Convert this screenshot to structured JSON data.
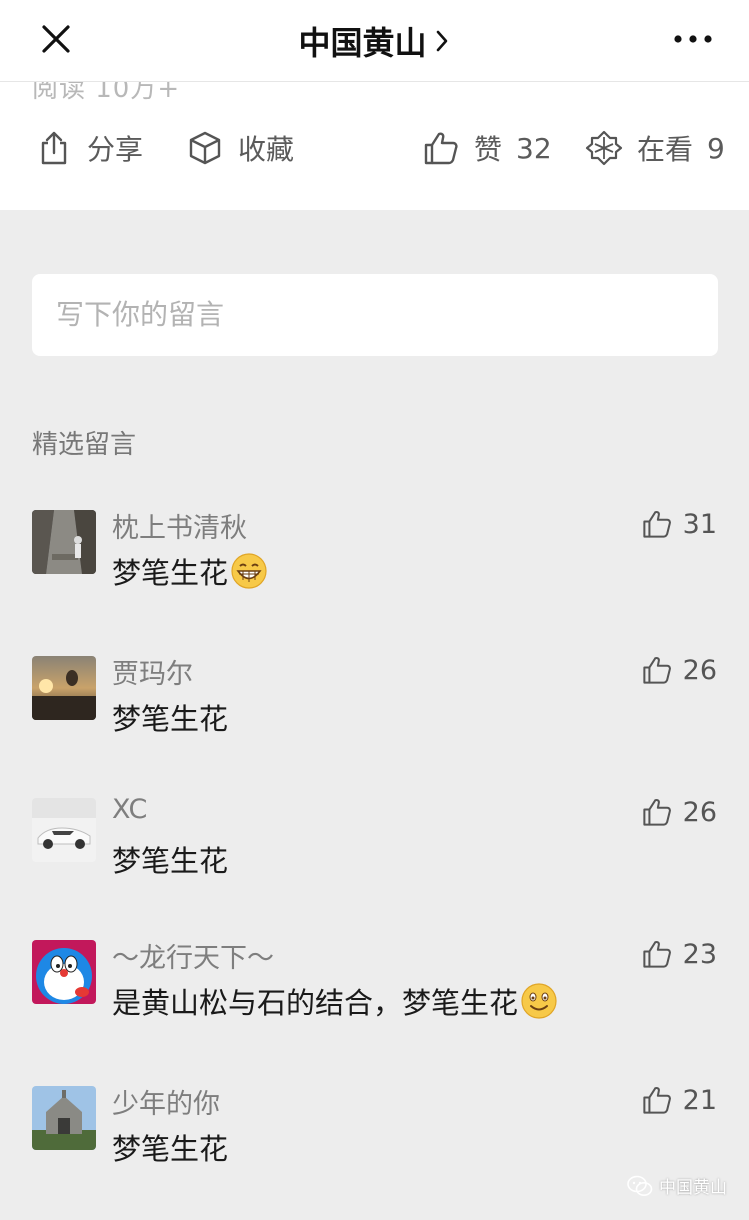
{
  "header": {
    "title": "中国黄山",
    "peek_text": "阅读 10万+"
  },
  "actions": {
    "share": "分享",
    "favorite": "收藏",
    "like_label": "赞",
    "like_count": "32",
    "looking_label": "在看",
    "looking_count": "9"
  },
  "comment_input": {
    "placeholder": "写下你的留言"
  },
  "comments_section": {
    "title": "精选留言",
    "items": [
      {
        "name": "枕上书清秋",
        "text": "梦笔生花",
        "likes": "31",
        "emoji": "grinning-emoji"
      },
      {
        "name": "贾玛尔",
        "text": "梦笔生花",
        "likes": "26"
      },
      {
        "name": "XC",
        "text": "梦笔生花",
        "likes": "26"
      },
      {
        "name": "～龙行天下～",
        "text": "是黄山松与石的结合，梦笔生花",
        "likes": "23",
        "emoji": "smiling-emoji"
      },
      {
        "name": "少年的你",
        "text": "梦笔生花",
        "likes": "21"
      }
    ]
  },
  "watermark": {
    "label": "中国黄山"
  },
  "colors": {
    "page_bg": "#ededed",
    "card_bg": "#ffffff",
    "muted_text": "#7e7e7e"
  }
}
